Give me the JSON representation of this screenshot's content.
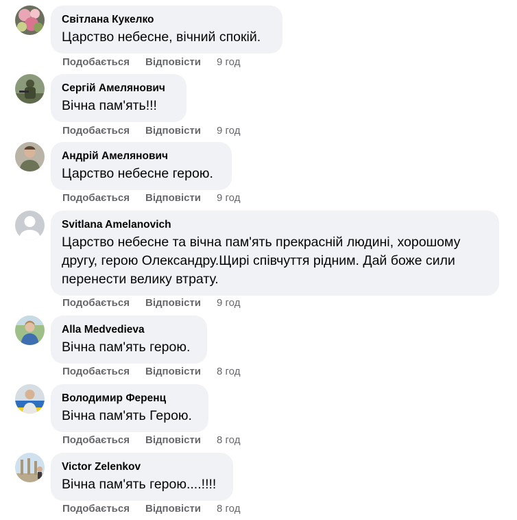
{
  "comments": [
    {
      "author": "Світлана Кукелко",
      "text": "Царство небесне, вічний спокій.",
      "like": "Подобається",
      "reply": "Відповісти",
      "time": "9 год",
      "avatar_icon": "flowers-avatar-icon"
    },
    {
      "author": "Сергій Амелянович",
      "text": "Вічна пам'ять!!!",
      "like": "Подобається",
      "reply": "Відповісти",
      "time": "9 год",
      "avatar_icon": "soldier-avatar-icon"
    },
    {
      "author": "Андрій Амелянович",
      "text": "Царство небесне герою.",
      "like": "Подобається",
      "reply": "Відповісти",
      "time": "9 год",
      "avatar_icon": "person-avatar-icon"
    },
    {
      "author": "Svitlana Amelanovich",
      "text": "Царство небесне та вічна пам'ять прекрасній людині, хорошому\nдругу, герою Олександру.Щирі співчуття рідним. Дай боже сили\nперенести велику втрату.",
      "like": "Подобається",
      "reply": "Відповісти",
      "time": "9 год",
      "avatar_icon": "default-avatar-icon"
    },
    {
      "author": "Alla Medvedieva",
      "text": "Вічна пам'ять герою.",
      "like": "Подобається",
      "reply": "Відповісти",
      "time": "8 год",
      "avatar_icon": "person-outdoor-avatar-icon"
    },
    {
      "author": "Володимир Ференц",
      "text": "Вічна пам'ять Герою.",
      "like": "Подобається",
      "reply": "Відповісти",
      "time": "8 год",
      "avatar_icon": "person-flag-avatar-icon"
    },
    {
      "author": "Victor Zelenkov",
      "text": "Вічна пам'ять герою....!!!!",
      "like": "Подобається",
      "reply": "Відповісти",
      "time": "8 год",
      "avatar_icon": "ruins-avatar-icon"
    }
  ],
  "colors": {
    "bubble": "#f0f2f5",
    "text": "#050505",
    "secondary": "#65676b"
  }
}
